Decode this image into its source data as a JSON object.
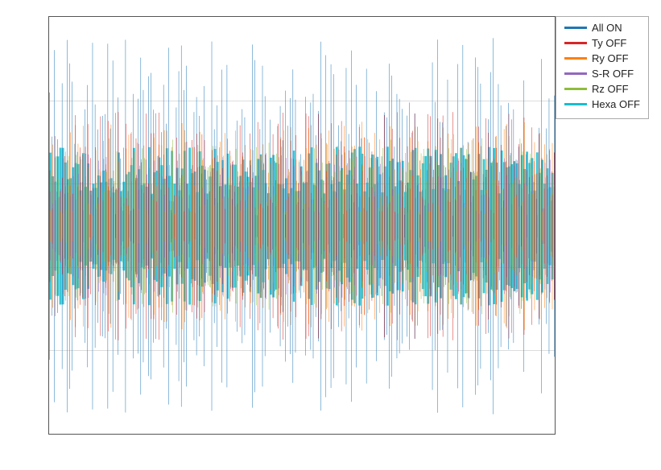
{
  "chart": {
    "title": "",
    "x_axis": {},
    "y_axis": {}
  },
  "legend": {
    "items": [
      {
        "label": "All ON",
        "color": "#1f77b4"
      },
      {
        "label": "Ty OFF",
        "color": "#d62728"
      },
      {
        "label": "Ry OFF",
        "color": "#ff7f0e"
      },
      {
        "label": "S-R OFF",
        "color": "#9467bd"
      },
      {
        "label": "Rz OFF",
        "color": "#8fbc3c"
      },
      {
        "label": "Hexa OFF",
        "color": "#17becf"
      }
    ]
  }
}
